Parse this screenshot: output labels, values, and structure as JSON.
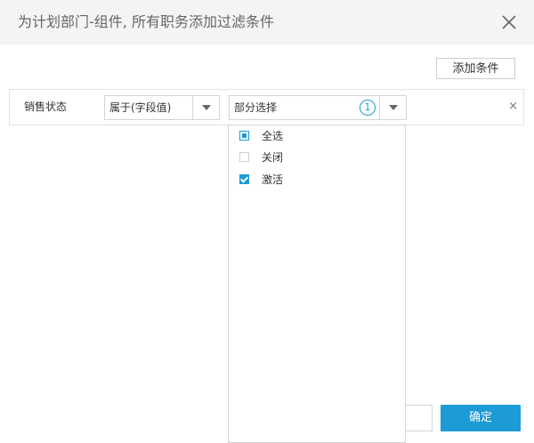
{
  "dialog": {
    "title": "为计划部门-组件, 所有职务添加过滤条件",
    "close_icon": "close-icon"
  },
  "toolbar": {
    "add_condition_label": "添加条件"
  },
  "condition": {
    "field_label": "销售状态",
    "operator": {
      "selected": "属于(字段值)",
      "arrow_icon": "triangle-down-icon"
    },
    "value": {
      "selected": "部分选择",
      "selected_count": "1",
      "arrow_icon": "triangle-down-icon"
    },
    "remove_symbol": "×"
  },
  "dropdown": {
    "options": [
      {
        "label": "全选",
        "state": "partial"
      },
      {
        "label": "关闭",
        "state": "unchecked"
      },
      {
        "label": "激活",
        "state": "checked"
      }
    ]
  },
  "footer": {
    "ok_label": "确定"
  },
  "colors": {
    "accent": "#1c9bd6",
    "header_bg": "#f4f4f4",
    "border": "#d4d4d4"
  }
}
